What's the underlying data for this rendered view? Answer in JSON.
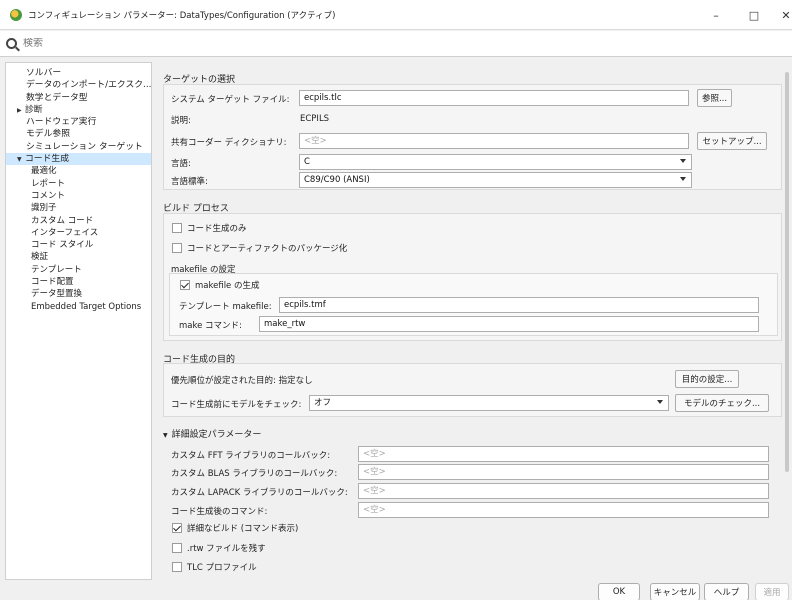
{
  "window": {
    "title": "コンフィギュレーション パラメーター: DataTypes/Configuration (アクティブ)",
    "minimize": "–",
    "maximize": "□",
    "close": "✕"
  },
  "search": {
    "placeholder": "検索"
  },
  "tree": {
    "items": [
      {
        "label": "ソルバー"
      },
      {
        "label": "データのインポート/エクスク..."
      },
      {
        "label": "数学とデータ型"
      },
      {
        "label": "診断",
        "arrow": "▶"
      },
      {
        "label": "ハードウェア実行"
      },
      {
        "label": "モデル参照"
      },
      {
        "label": "シミュレーション ターゲット"
      },
      {
        "label": "コード生成",
        "arrow": "▼"
      },
      {
        "label": "最適化"
      },
      {
        "label": "レポート"
      },
      {
        "label": "コメント"
      },
      {
        "label": "識別子"
      },
      {
        "label": "カスタム コード"
      },
      {
        "label": "インターフェイス"
      },
      {
        "label": "コード スタイル"
      },
      {
        "label": "検証"
      },
      {
        "label": "テンプレート"
      },
      {
        "label": "コード配置"
      },
      {
        "label": "データ型置換"
      },
      {
        "label": "Embedded Target Options"
      }
    ]
  },
  "target": {
    "title": "ターゲットの選択",
    "stf_label": "システム ターゲット ファイル:",
    "stf_value": "ecpils.tlc",
    "browse_button": "参照...",
    "desc_label": "説明:",
    "desc_value": "ECPILS",
    "shared_label": "共有コーダー ディクショナリ:",
    "shared_value": "<空>",
    "setup_button": "セットアップ...",
    "lang_label": "言語:",
    "lang_value": "C",
    "std_label": "言語標準:",
    "std_value": "C89/C90 (ANSI)"
  },
  "build": {
    "title": "ビルド プロセス",
    "gen_only": "コード生成のみ",
    "package": "コードとアーティファクトのパッケージ化",
    "makefile_title": "makefile の設定",
    "gen_makefile": "makefile の生成",
    "template_label": "テンプレート makefile:",
    "template_value": "ecpils.tmf",
    "make_label": "make コマンド:",
    "make_value": "make_rtw"
  },
  "objectives": {
    "title": "コード生成の目的",
    "prioritized_label": "優先順位が設定された目的: 指定なし",
    "set_button": "目的の設定...",
    "check_label": "コード生成前にモデルをチェック:",
    "check_value": "オフ",
    "check_button": "モデルのチェック..."
  },
  "advanced": {
    "title": "詳細設定パラメーター",
    "fft_label": "カスタム FFT ライブラリのコールバック:",
    "fft_value": "<空>",
    "blas_label": "カスタム BLAS ライブラリのコールバック:",
    "blas_value": "<空>",
    "lapack_label": "カスタム LAPACK ライブラリのコールバック:",
    "lapack_value": "<空>",
    "post_label": "コード生成後のコマンド:",
    "post_value": "<空>",
    "verbose": "詳細なビルド (コマンド表示)",
    "retain_rtw": ".rtw ファイルを残す",
    "tlc_profile": "TLC プロファイル"
  },
  "footer": {
    "ok": "OK",
    "cancel": "キャンセル",
    "help": "ヘルプ",
    "apply": "適用"
  }
}
